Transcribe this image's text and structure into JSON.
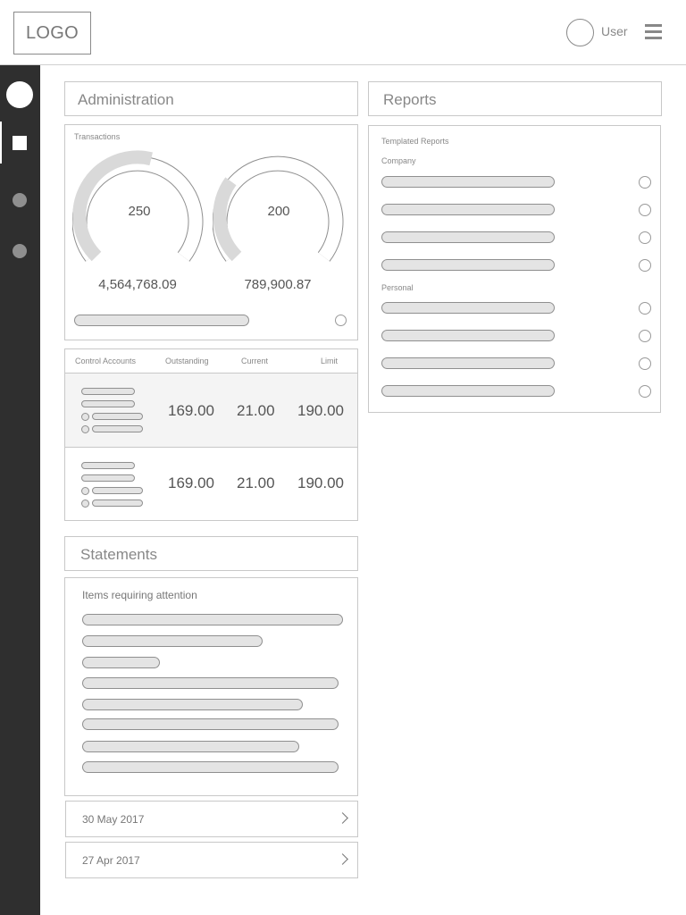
{
  "header": {
    "logo": "LOGO",
    "user_label": "User"
  },
  "sidebar": {
    "items": [
      {
        "icon": "home-circle-icon"
      },
      {
        "icon": "square-icon",
        "active": true
      },
      {
        "icon": "dot-icon"
      },
      {
        "icon": "dot-icon"
      }
    ]
  },
  "administration": {
    "title": "Administration",
    "transactions": {
      "label": "Transactions",
      "gauges": [
        {
          "value": "250",
          "amount": "4,564,768.09",
          "fill": 0.55
        },
        {
          "value": "200",
          "amount": "789,900.87",
          "fill": 0.3
        }
      ]
    },
    "control_accounts": {
      "headers": [
        "Control Accounts",
        "Outstanding",
        "Current",
        "Limit"
      ],
      "rows": [
        {
          "outstanding": "169.00",
          "current": "21.00",
          "limit": "190.00"
        },
        {
          "outstanding": "169.00",
          "current": "21.00",
          "limit": "190.00"
        }
      ]
    }
  },
  "statements": {
    "title": "Statements",
    "attention_label": "Items requiring attention",
    "dates": [
      "30 May 2017",
      "27 Apr 2017"
    ]
  },
  "reports": {
    "title": "Reports",
    "templated_label": "Templated Reports",
    "company_label": "Company",
    "personal_label": "Personal"
  },
  "colors": {
    "sidebar": "#2f2f2f",
    "border": "#c8c8c8",
    "pill_fill": "#e4e4e4",
    "gauge_fill": "#d9d9d9"
  }
}
